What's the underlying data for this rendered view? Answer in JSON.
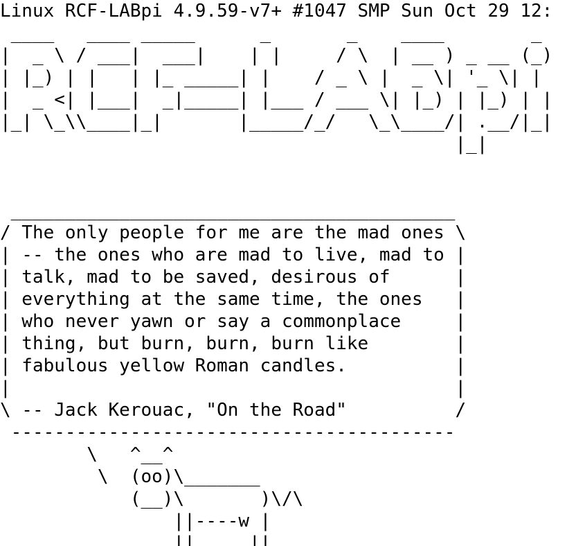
{
  "terminal": {
    "colors": {
      "background": "#ffffff",
      "foreground": "#000000"
    },
    "system_line": "Linux RCF-LABpi 4.9.59-v7+ #1047 SMP Sun Oct 29 12:",
    "banner": [
      " ____   ____ _____      _       _    ____        _ ",
      "|  _ \\ / ___|  ___|    | |     / \\  | __ ) _ __ (_)",
      "| |_) | |   | |_ _____| |    / _ \\ |  _ \\| '_ \\| |",
      "|  _ <| |___|  _|_____| |___ / ___ \\| |_) | |_) | |",
      "|_| \\_\\\\____|_|       |_____/_/   \\_\\____/| .__/|_|",
      "                                          |_|      "
    ],
    "spacer": [
      "",
      ""
    ],
    "quote_box": [
      " _________________________________________",
      "/ The only people for me are the mad ones \\",
      "| -- the ones who are mad to live, mad to |",
      "| talk, mad to be saved, desirous of      |",
      "| everything at the same time, the ones   |",
      "| who never yawn or say a commonplace     |",
      "| thing, but burn, burn, burn like        |",
      "| fabulous yellow Roman candles.          |",
      "|                                         |",
      "\\ -- Jack Kerouac, \"On the Road\"          /",
      " -----------------------------------------"
    ],
    "cow": [
      "        \\   ^__^",
      "         \\  (oo)\\_______",
      "            (__)\\       )\\/\\",
      "                ||----w |",
      "                ||     ||"
    ]
  }
}
